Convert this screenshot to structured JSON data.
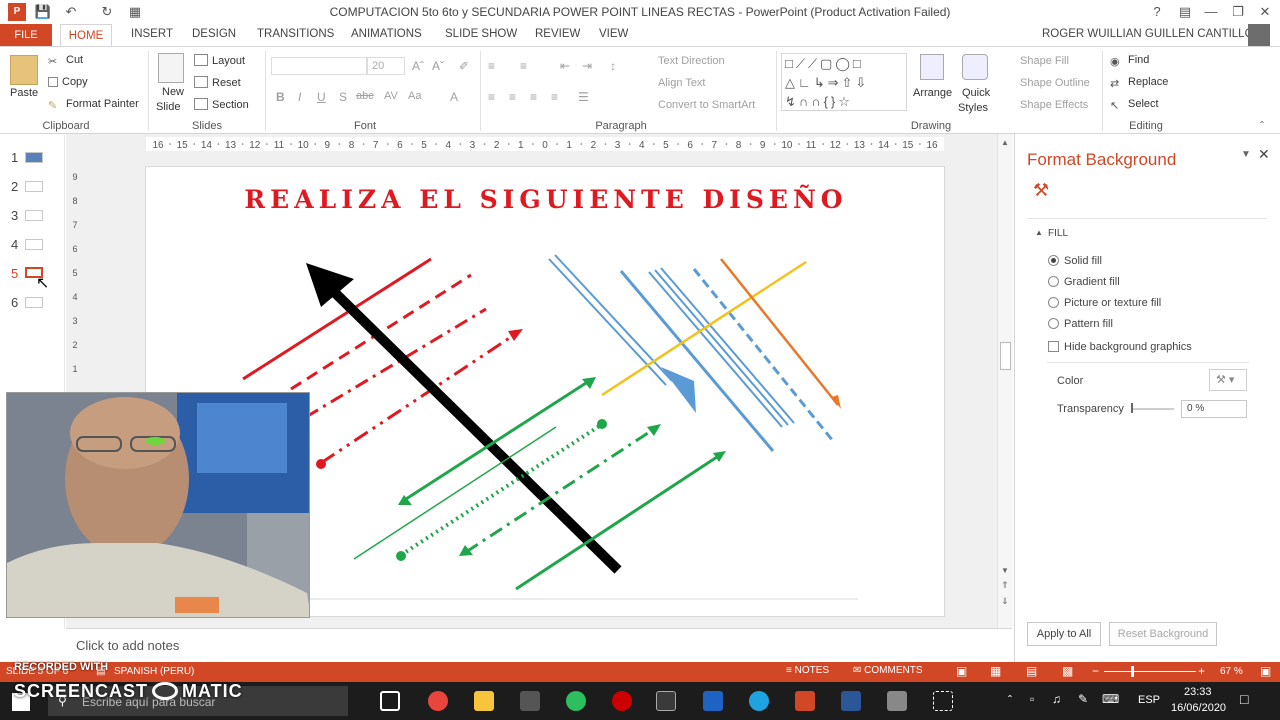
{
  "window": {
    "title": "COMPUTACION 5to 6to y SECUNDARIA  POWER POINT LINEAS RECTAS - PowerPoint (Product Activation Failed)",
    "user": "ROGER WUILLIAN GUILLEN CANTILLO"
  },
  "tabs": [
    "FILE",
    "HOME",
    "INSERT",
    "DESIGN",
    "TRANSITIONS",
    "ANIMATIONS",
    "SLIDE SHOW",
    "REVIEW",
    "VIEW"
  ],
  "ribbon": {
    "clipboard": {
      "paste": "Paste",
      "cut": "Cut",
      "copy": "Copy",
      "format_painter": "Format Painter",
      "label": "Clipboard"
    },
    "slides": {
      "new_slide": "New",
      "new_slide2": "Slide",
      "layout": "Layout",
      "reset": "Reset",
      "section": "Section",
      "label": "Slides"
    },
    "font": {
      "size": "20",
      "label": "Font"
    },
    "paragraph": {
      "text_direction": "Text Direction",
      "align_text": "Align Text",
      "convert": "Convert to SmartArt",
      "label": "Paragraph"
    },
    "drawing": {
      "arrange": "Arrange",
      "quick_styles": "Quick",
      "quick_styles2": "Styles",
      "shape_fill": "Shape Fill",
      "shape_outline": "Shape Outline",
      "shape_effects": "Shape Effects",
      "label": "Drawing"
    },
    "editing": {
      "find": "Find",
      "replace": "Replace",
      "select": "Select",
      "label": "Editing"
    }
  },
  "thumbnails": [
    "1",
    "2",
    "3",
    "4",
    "5",
    "6"
  ],
  "ruler": {
    "h_ticks": [
      "16",
      "15",
      "14",
      "13",
      "12",
      "11",
      "10",
      "9",
      "8",
      "7",
      "6",
      "5",
      "4",
      "3",
      "2",
      "1",
      "0",
      "1",
      "2",
      "3",
      "4",
      "5",
      "6",
      "7",
      "8",
      "9",
      "10",
      "11",
      "12",
      "13",
      "14",
      "15",
      "16"
    ],
    "v_ticks": [
      "9",
      "8",
      "7",
      "6",
      "5",
      "4",
      "3",
      "2",
      "1"
    ]
  },
  "slide": {
    "title": "REALIZA EL SIGUIENTE DISEÑO"
  },
  "notes": {
    "placeholder": "Click to add notes"
  },
  "format_background": {
    "title": "Format Background",
    "section": "FILL",
    "options": [
      "Solid fill",
      "Gradient fill",
      "Picture or texture fill",
      "Pattern fill"
    ],
    "selected": "Solid fill",
    "hide_graphics": "Hide background graphics",
    "color_label": "Color",
    "transparency_label": "Transparency",
    "transparency_value": "0 %",
    "apply_all": "Apply to All",
    "reset": "Reset Background"
  },
  "status": {
    "slide": "SLIDE 5 OF 6",
    "language": "SPANISH (PERU)",
    "notes": "NOTES",
    "comments": "COMMENTS",
    "zoom": "67 %"
  },
  "watermark": {
    "recorded": "RECORDED WITH",
    "brand": "SCREENCAST",
    "brand2": "MATIC"
  },
  "taskbar": {
    "search": "Escribe aquí para buscar",
    "time": "23:33",
    "date": "16/06/2020",
    "lang": "ESP"
  },
  "colors": {
    "accent": "#d24726",
    "title_red": "#e0181f",
    "green": "#1fa64a",
    "blue": "#5b9bd5",
    "orange": "#e8782a",
    "yellow": "#f2c21a"
  }
}
